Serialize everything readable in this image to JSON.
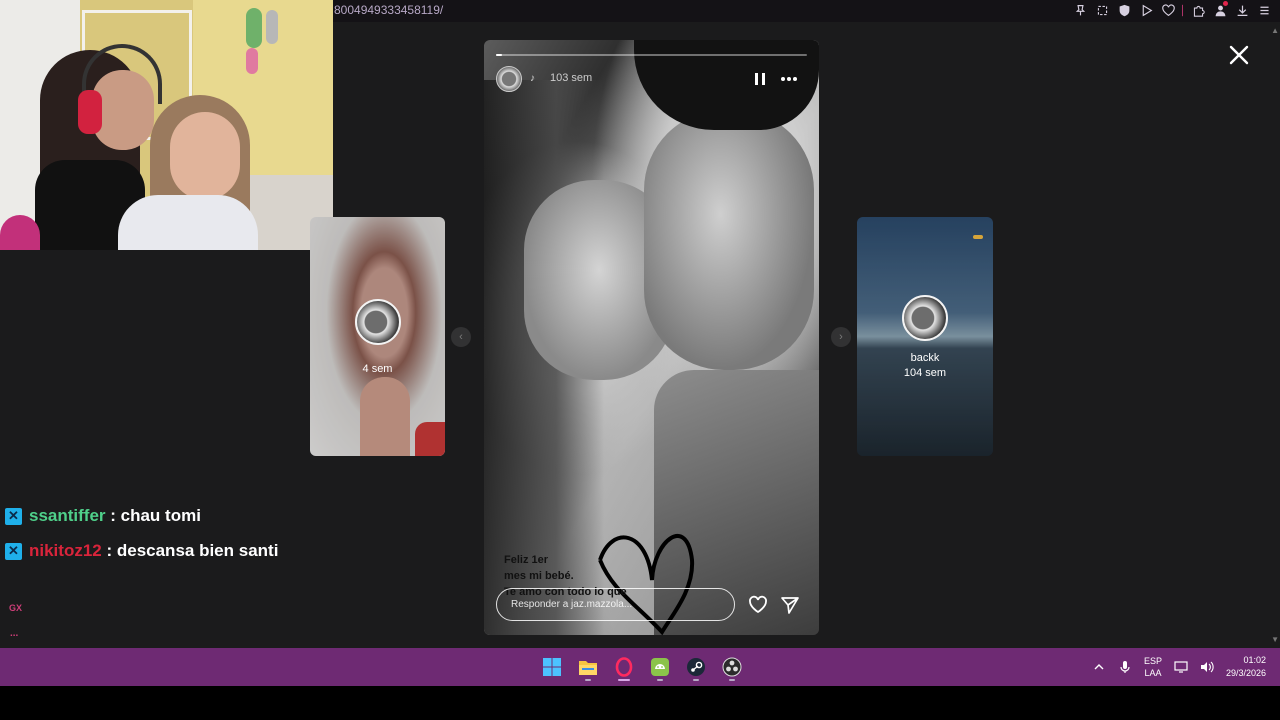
{
  "browser": {
    "url": "8004949333458119/",
    "toolbar_icons": [
      "pin-icon",
      "screenshot-icon",
      "shield-icon",
      "play-icon",
      "heart-icon",
      "extensions-icon",
      "profile-icon",
      "download-icon",
      "menu-icon"
    ]
  },
  "story": {
    "progress": 0.02,
    "time": "103 sem",
    "caption": "Feliz 1er\nmes mi bebé.\nTe amo con todo lo que",
    "reply_placeholder": "Responder a jaz.mazzola..."
  },
  "prev_story": {
    "time": "4 sem"
  },
  "next_story": {
    "name": "backk",
    "time": "104 sem"
  },
  "chat": {
    "messages": [
      {
        "user": "ssantiffer",
        "separator": " : ",
        "text": "chau tomi",
        "color": "#4fd08a"
      },
      {
        "user": "nikitoz12",
        "separator": " : ",
        "text": "descansa bien santi",
        "color": "#d9243b"
      }
    ],
    "footer_tag": "GX",
    "footer_more": "..."
  },
  "taskbar": {
    "apps": [
      "windows-start-icon",
      "file-explorer-icon",
      "opera-gx-icon",
      "android-icon",
      "steam-icon",
      "obs-icon"
    ],
    "language_line1": "ESP",
    "language_line2": "LAA",
    "time": "01:02",
    "date": "29/3/2026"
  },
  "colors": {
    "taskbar": "#6e2a73",
    "accent": "#d9a7e6"
  }
}
